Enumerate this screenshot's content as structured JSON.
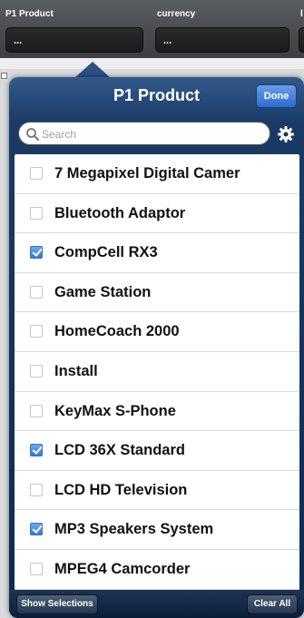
{
  "filters": [
    {
      "label": "P1 Product",
      "value": "..."
    },
    {
      "label": "currency",
      "value": "..."
    },
    {
      "label": "l",
      "value": ""
    }
  ],
  "popover": {
    "title": "P1  Product",
    "done_label": "Done",
    "search_placeholder": "Search",
    "items": [
      {
        "label": "7 Megapixel Digital Camer",
        "checked": false
      },
      {
        "label": "Bluetooth Adaptor",
        "checked": false
      },
      {
        "label": "CompCell RX3",
        "checked": true
      },
      {
        "label": "Game Station",
        "checked": false
      },
      {
        "label": "HomeCoach 2000",
        "checked": false
      },
      {
        "label": "Install",
        "checked": false
      },
      {
        "label": "KeyMax S-Phone",
        "checked": false
      },
      {
        "label": "LCD 36X Standard",
        "checked": true
      },
      {
        "label": "LCD HD Television",
        "checked": false
      },
      {
        "label": "MP3 Speakers System",
        "checked": true
      },
      {
        "label": "MPEG4 Camcorder",
        "checked": false
      }
    ],
    "show_selections_label": "Show Selections",
    "clear_all_label": "Clear All"
  },
  "colors": {
    "header_blue": "#1b3b66",
    "done_blue": "#2c6ad4",
    "checkbox_blue": "#2f7be3"
  }
}
